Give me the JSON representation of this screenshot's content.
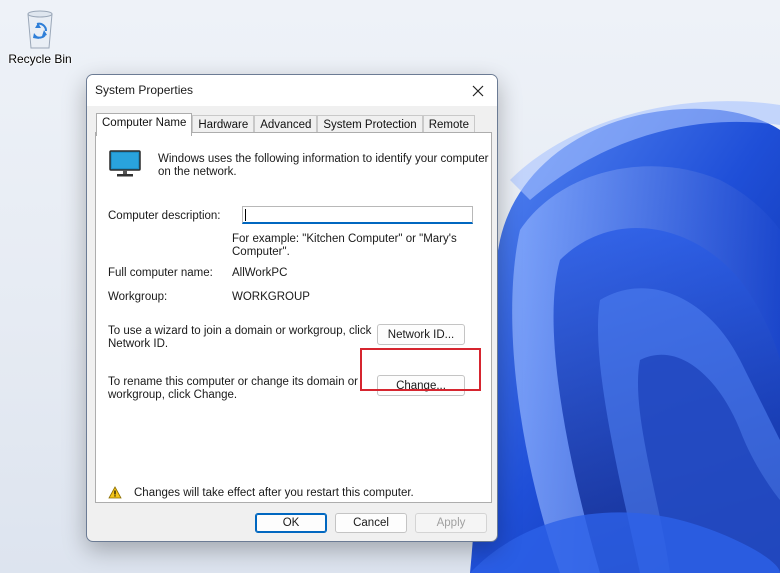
{
  "desktop": {
    "recycle_bin_label": "Recycle Bin"
  },
  "dialog": {
    "title": "System Properties",
    "tabs": [
      "Computer Name",
      "Hardware",
      "Advanced",
      "System Protection",
      "Remote"
    ],
    "active_tab": "Computer Name",
    "intro_line1": "Windows uses the following information to identify your computer",
    "intro_line2": "on the network.",
    "computer_description_label": "Computer description:",
    "computer_description_value": "",
    "example_line1": "For example: \"Kitchen Computer\" or \"Mary's",
    "example_line2": "Computer\".",
    "full_computer_name_label": "Full computer name:",
    "full_computer_name_value": "AllWorkPC",
    "workgroup_label": "Workgroup:",
    "workgroup_value": "WORKGROUP",
    "network_id_text_line1": "To use a wizard to join a domain or workgroup, click",
    "network_id_text_line2": "Network ID.",
    "network_id_button": "Network ID...",
    "rename_text_line1": "To rename this computer or change its domain or",
    "rename_text_line2": "workgroup, click Change.",
    "change_button": "Change...",
    "warning_text": "Changes will take effect after you restart this computer.",
    "ok_button": "OK",
    "cancel_button": "Cancel",
    "apply_button": "Apply"
  },
  "colors": {
    "accent": "#0067c0",
    "highlight": "#d6252f",
    "wallpaper_blue": "#1f4fd8"
  },
  "icons": [
    "recycle-bin-icon",
    "computer-monitor-icon",
    "close-icon",
    "warning-icon"
  ]
}
